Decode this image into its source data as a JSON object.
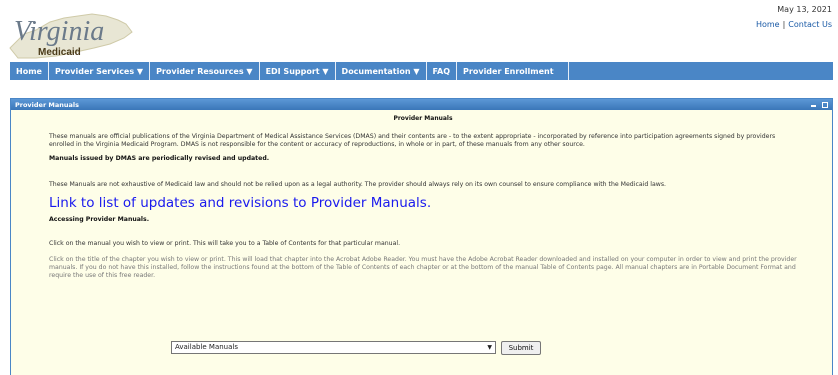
{
  "header": {
    "logo_text": "Virginia",
    "logo_subtext": "Medicaid",
    "date": "May 13, 2021",
    "home_link": "Home",
    "separator": "|",
    "contact_link": "Contact Us"
  },
  "nav": {
    "items": [
      {
        "label": "Home"
      },
      {
        "label": "Provider Services ▼"
      },
      {
        "label": "Provider Resources ▼"
      },
      {
        "label": "EDI Support ▼"
      },
      {
        "label": "Documentation ▼"
      },
      {
        "label": "FAQ"
      },
      {
        "label": "Provider Enrollment"
      }
    ]
  },
  "panel": {
    "title": "Provider Manuals",
    "heading": "Provider Manuals",
    "para1": "These manuals are official publications of the Virginia Department of Medical Assistance Services (DMAS) and their contents are - to the extent appropriate - incorporated by reference into participation agreements signed by providers enrolled in the Virginia Medicaid Program. DMAS is not responsible for the content or accuracy of reproductions, in whole or in part, of these manuals from any other source.",
    "bold_note": "Manuals issued by DMAS are periodically revised and updated.",
    "para2": "These Manuals are not exhaustive of Medicaid law and should not be relied upon as a legal authority. The provider should always rely on its own counsel to ensure compliance with the Medicaid laws.",
    "big_link": "Link to list of updates and revisions to Provider Manuals.",
    "accessing": "Accessing Provider Manuals.",
    "para3": "Click on the manual you wish to view or print. This will take you to a Table of Contents for that particular manual.",
    "para4": "Click on the title of the chapter you wish to view or print. This will load that chapter into the Acrobat Adobe Reader. You must have the Adobe Acrobat Reader downloaded and installed on your computer in order to view and print the provider manuals. If you do not have this installed, follow the instructions found at the bottom of the Table of Contents of each chapter or at the bottom of the manual Table of Contents page. All manual chapters are in Portable Document Format and require the use of this free reader.",
    "select_value": "Available Manuals",
    "submit_label": "Submit"
  },
  "colors": {
    "nav_bg": "#4a86c6",
    "panel_bg": "#fefee8",
    "link": "#1a1aee"
  }
}
